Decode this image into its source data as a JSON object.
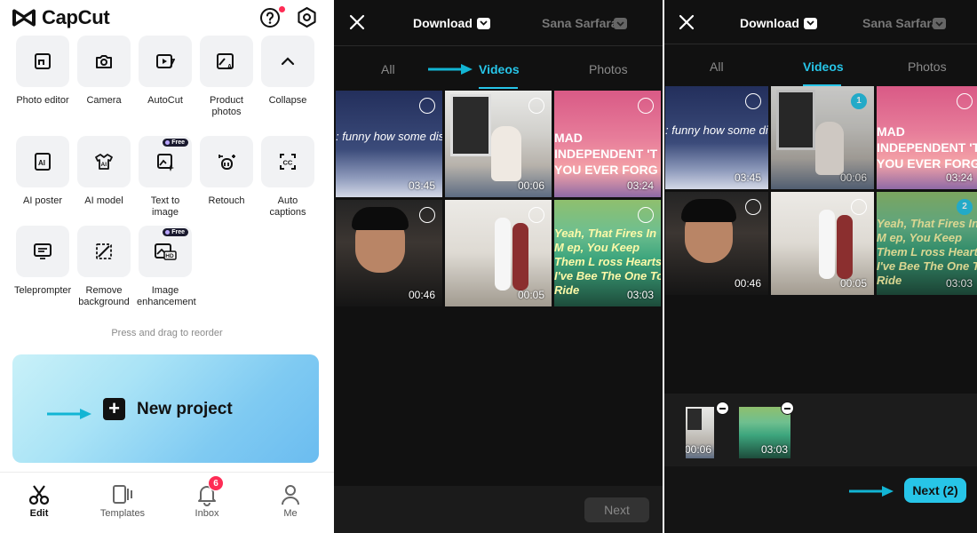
{
  "home": {
    "app_name": "CapCut",
    "tools": [
      {
        "label": "Photo editor",
        "icon": "photo-editor-icon"
      },
      {
        "label": "Camera",
        "icon": "camera-icon"
      },
      {
        "label": "AutoCut",
        "icon": "autocut-icon"
      },
      {
        "label": "Product photos",
        "icon": "product-photos-icon"
      },
      {
        "label": "Collapse",
        "icon": "chevron-up-icon"
      },
      {
        "label": "AI poster",
        "icon": "ai-poster-icon"
      },
      {
        "label": "AI model",
        "icon": "ai-model-icon"
      },
      {
        "label": "Text to image",
        "icon": "text-to-image-icon",
        "badge": "Free"
      },
      {
        "label": "Retouch",
        "icon": "retouch-icon"
      },
      {
        "label": "Auto captions",
        "icon": "auto-captions-icon"
      },
      {
        "label": "Teleprompter",
        "icon": "teleprompter-icon"
      },
      {
        "label": "Remove background",
        "icon": "remove-background-icon"
      },
      {
        "label": "Image enhancement",
        "icon": "image-enhancement-icon",
        "badge": "Free"
      }
    ],
    "reorder_hint": "Press and drag to reorder",
    "new_project_label": "New project",
    "nav": [
      {
        "label": "Edit",
        "icon": "scissors-icon"
      },
      {
        "label": "Templates",
        "icon": "templates-icon"
      },
      {
        "label": "Inbox",
        "icon": "bell-icon"
      },
      {
        "label": "Me",
        "icon": "person-icon"
      }
    ],
    "inbox_badge": "6"
  },
  "picker": {
    "title": "Download",
    "user": "Sana Sarfara",
    "tabs": [
      "All",
      "Videos",
      "Photos"
    ],
    "active_tab": "Videos",
    "items": [
      {
        "duration": "03:45",
        "caption": ": funny how some distan kes everything seem sn"
      },
      {
        "duration": "00:06",
        "caption": ""
      },
      {
        "duration": "03:24",
        "caption": "MAD INDEPENDENT 'T YOU EVER FORG"
      },
      {
        "duration": "00:46",
        "caption": ""
      },
      {
        "duration": "00:05",
        "caption": ""
      },
      {
        "duration": "03:03",
        "caption": "Yeah, That Fires In M ep, You Keep Them L ross Hearts I've Bee The One To Ride"
      }
    ],
    "next_label": "Next"
  },
  "picker_selected": {
    "title": "Download",
    "user": "Sana Sarfara",
    "tabs": [
      "All",
      "Videos",
      "Photos"
    ],
    "active_tab": "Videos",
    "selection_numbers": {
      "1": "1",
      "5": "2"
    },
    "tray": [
      {
        "duration": "00:06"
      },
      {
        "duration": "03:03"
      }
    ],
    "next_label": "Next (2)"
  },
  "colors": {
    "accent": "#27c5e8",
    "badge_red": "#fe2c55",
    "dark_bg": "#111111"
  }
}
